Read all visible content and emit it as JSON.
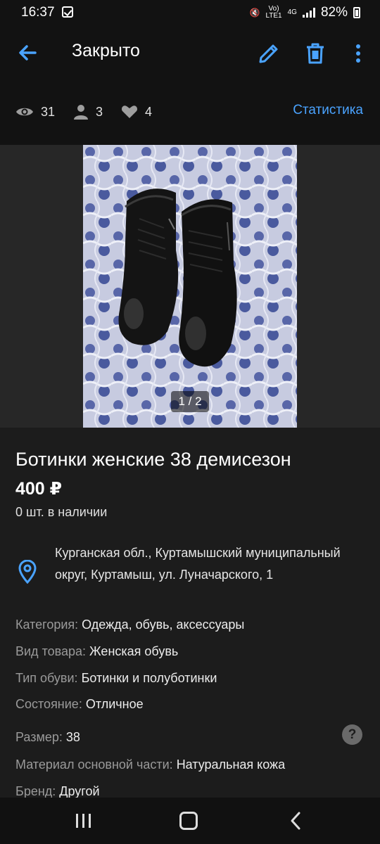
{
  "status_bar": {
    "time": "16:37",
    "volte_label": "Vo)",
    "lte_label": "LTE1",
    "network_label": "4G",
    "battery": "82%"
  },
  "header": {
    "title": "Закрыто",
    "stats": {
      "views": "31",
      "contacts": "3",
      "favorites": "4"
    },
    "stats_link": "Статистика"
  },
  "gallery": {
    "counter": "1 / 2"
  },
  "product": {
    "title": "Ботинки женские 38 демисезон",
    "price": "400 ₽",
    "stock": "0 шт. в наличии",
    "address": "Курганская обл., Куртамышский муниципальный округ, Куртамыш, ул. Луначарского, 1"
  },
  "attributes": [
    {
      "key": "Категория:",
      "value": "Одежда, обувь, аксессуары"
    },
    {
      "key": "Вид товара:",
      "value": "Женская обувь"
    },
    {
      "key": "Тип обуви:",
      "value": "Ботинки и полуботинки"
    },
    {
      "key": "Состояние:",
      "value": "Отличное"
    },
    {
      "key": "Размер:",
      "value": "38"
    },
    {
      "key": "Материал основной части:",
      "value": "Натуральная кожа"
    },
    {
      "key": "Бренд:",
      "value": "Другой"
    }
  ],
  "help_glyph": "?",
  "colors": {
    "accent": "#4aa3ff",
    "background": "#1c1c1c",
    "header": "#121212"
  },
  "icons": [
    "back-arrow-icon",
    "edit-pencil-icon",
    "trash-icon",
    "more-vertical-icon",
    "eye-icon",
    "person-icon",
    "heart-icon",
    "location-pin-icon",
    "help-icon"
  ]
}
